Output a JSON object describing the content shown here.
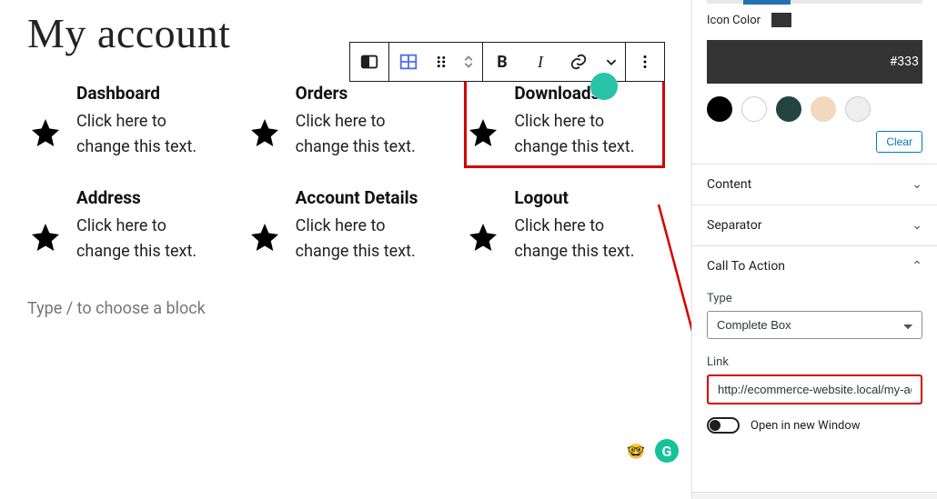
{
  "page": {
    "title": "My account",
    "block_placeholder": "Type / to choose a block"
  },
  "toolbar": {
    "bold": "B",
    "italic": "I"
  },
  "boxes": [
    {
      "title": "Dashboard",
      "desc": "Click here to change this text.",
      "selected": false
    },
    {
      "title": "Orders",
      "desc": "Click here to change this text.",
      "selected": false
    },
    {
      "title": "Downloads",
      "desc": "Click here to change this text.",
      "selected": true
    },
    {
      "title": "Address",
      "desc": "Click here to change this text.",
      "selected": false
    },
    {
      "title": "Account Details",
      "desc": "Click here to change this text.",
      "selected": false
    },
    {
      "title": "Logout",
      "desc": "Click here to change this text.",
      "selected": false
    }
  ],
  "sidebar": {
    "icon_color_label": "Icon Color",
    "hex_value": "#333",
    "clear_label": "Clear",
    "sections": {
      "content": "Content",
      "separator": "Separator",
      "cta": "Call To Action"
    },
    "cta": {
      "type_label": "Type",
      "type_value": "Complete Box",
      "link_label": "Link",
      "link_value": "http://ecommerce-website.local/my-ac",
      "open_new_label": "Open in new Window"
    }
  },
  "floats": {
    "grammarly": "G"
  }
}
